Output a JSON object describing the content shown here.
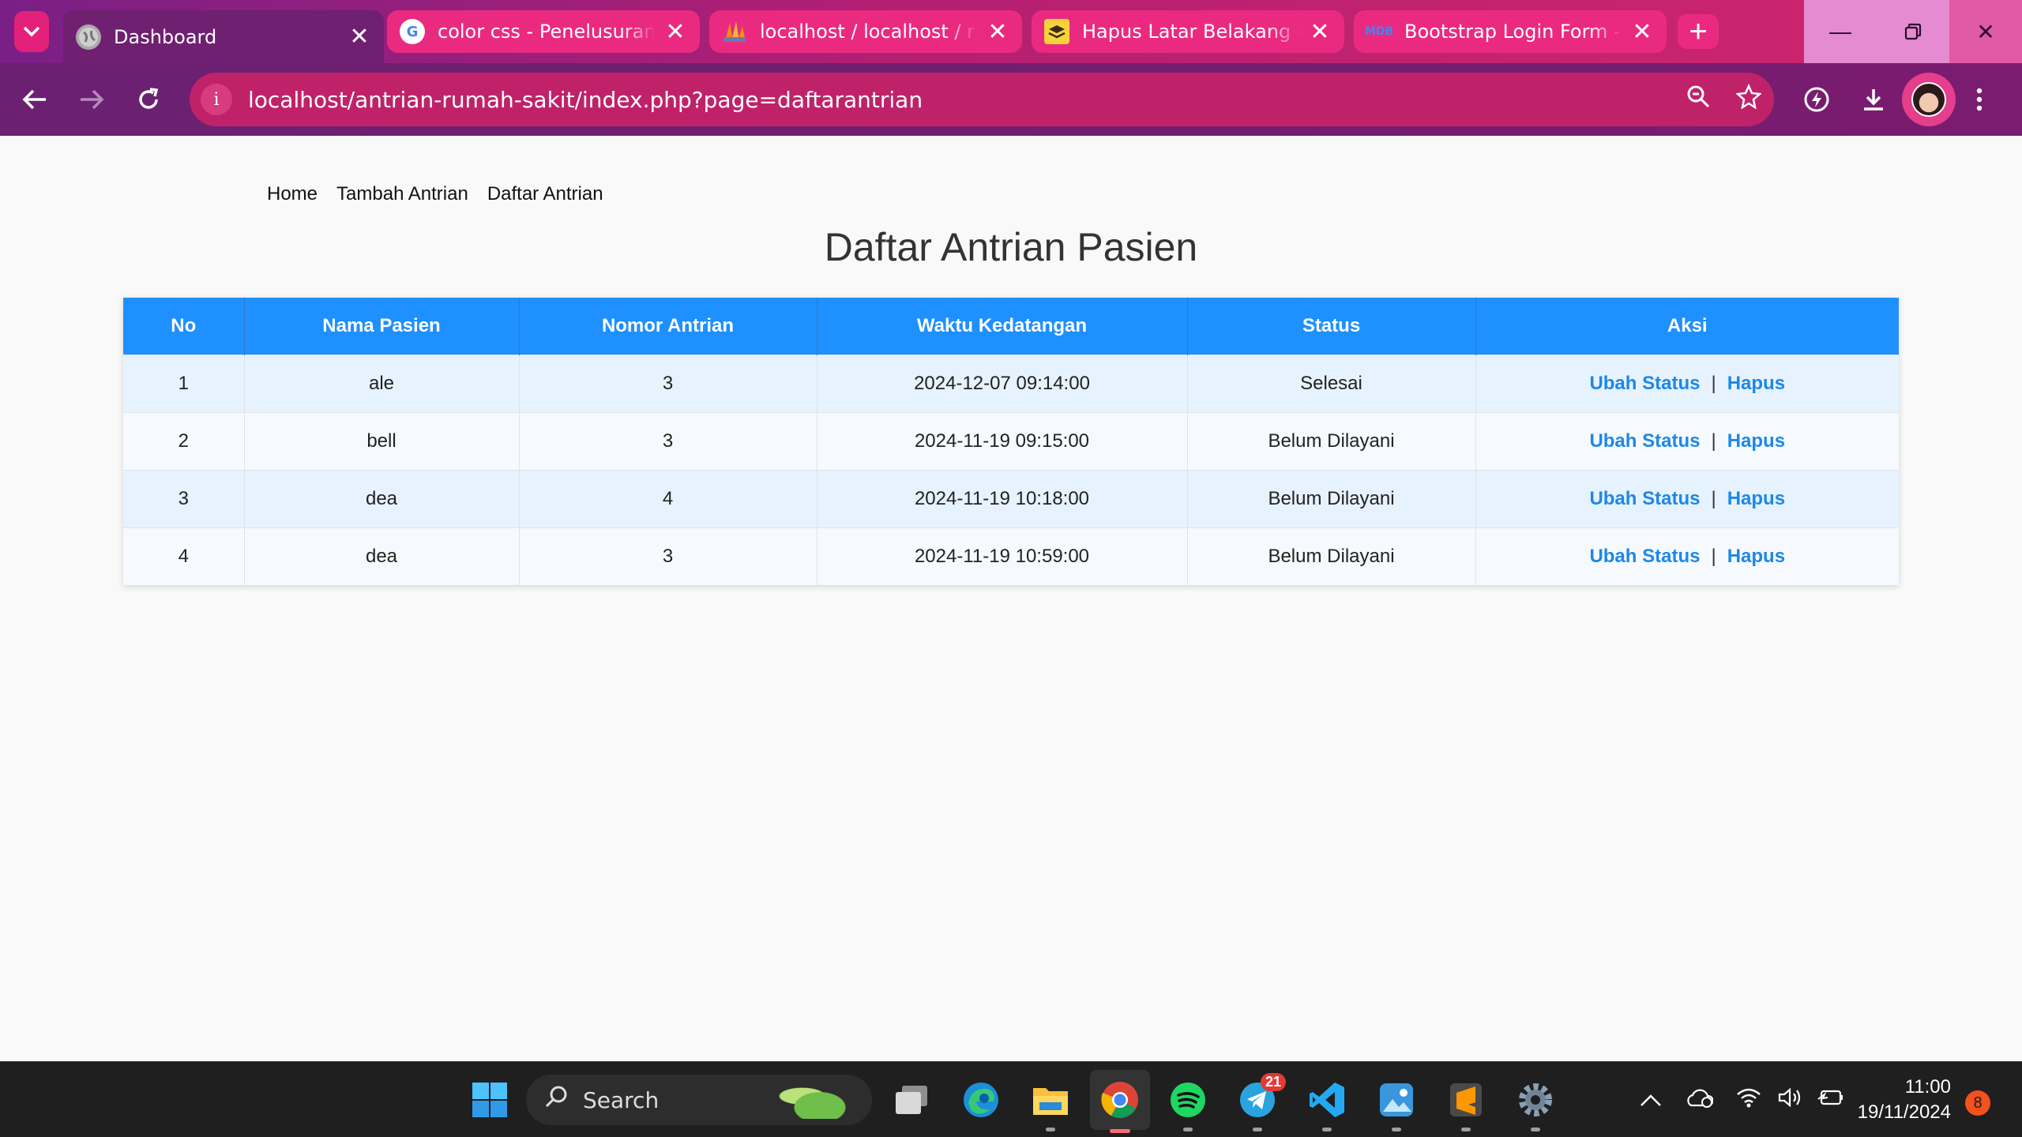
{
  "browser": {
    "tabs": [
      {
        "title": "Dashboard",
        "active": true,
        "icon": "globe-icon"
      },
      {
        "title": "color css - Penelusuran Google",
        "active": false,
        "icon": "google-icon"
      },
      {
        "title": "localhost / localhost / rumah sakit",
        "active": false,
        "icon": "phpmyadmin-icon"
      },
      {
        "title": "Hapus Latar Belakang dari Gambar",
        "active": false,
        "icon": "layers-icon"
      },
      {
        "title": "Bootstrap Login Form - free",
        "active": false,
        "icon": "mdb-icon"
      }
    ],
    "url": "localhost/antrian-rumah-sakit/index.php?page=daftarantrian",
    "colors": {
      "tabstrip": "#b41f72",
      "active_tab": "#6f2070",
      "omnibox": "#c0226a"
    }
  },
  "nav": {
    "links": [
      "Home",
      "Tambah Antrian",
      "Daftar Antrian"
    ]
  },
  "page": {
    "title": "Daftar Antrian Pasien"
  },
  "table": {
    "headers": [
      "No",
      "Nama Pasien",
      "Nomor Antrian",
      "Waktu Kedatangan",
      "Status",
      "Aksi"
    ],
    "rows": [
      {
        "no": "1",
        "name": "ale",
        "number": "3",
        "time": "2024-12-07 09:14:00",
        "status": "Selesai"
      },
      {
        "no": "2",
        "name": "bell",
        "number": "3",
        "time": "2024-11-19 09:15:00",
        "status": "Belum Dilayani"
      },
      {
        "no": "3",
        "name": "dea",
        "number": "4",
        "time": "2024-11-19 10:18:00",
        "status": "Belum Dilayani"
      },
      {
        "no": "4",
        "name": "dea",
        "number": "3",
        "time": "2024-11-19 10:59:00",
        "status": "Belum Dilayani"
      }
    ],
    "actions": {
      "edit": "Ubah Status",
      "separator": "|",
      "delete": "Hapus"
    },
    "colors": {
      "header": "#1e90ff",
      "link": "#1e88e5"
    }
  },
  "taskbar": {
    "search_label": "Search",
    "telegram_badge": "21",
    "clock_time": "11:00",
    "clock_date": "19/11/2024",
    "notification_count": "8"
  }
}
